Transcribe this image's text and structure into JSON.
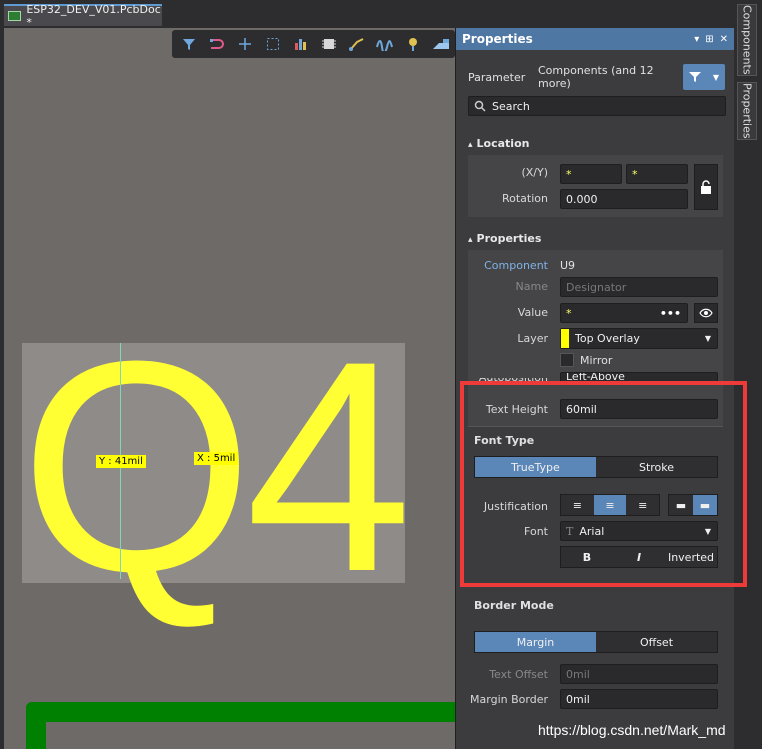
{
  "document_tab": {
    "title": "ESP32_DEV_V01.PcbDoc *"
  },
  "canvas": {
    "designator_text": "Q4",
    "y_tag": "Y : 41mil",
    "x_tag": "X : 5mil"
  },
  "toolbar_icons": [
    "filter-icon",
    "route-icon",
    "cross-icon",
    "select-box-icon",
    "chart-icon",
    "component-icon",
    "route-arc-icon",
    "meander-icon",
    "pin-icon",
    "layer-icon"
  ],
  "panel": {
    "title": "Properties",
    "header_buttons": [
      "▾",
      "⊞",
      "✕"
    ],
    "filter_label": "Parameter",
    "filter_value": "Components (and 12 more)",
    "search_placeholder": "Search",
    "location": {
      "section": "Location",
      "xy_label": "(X/Y)",
      "x_value": "*",
      "y_value": "*",
      "rotation_label": "Rotation",
      "rotation_value": "0.000"
    },
    "properties": {
      "section": "Properties",
      "component_label": "Component",
      "component_value": "U9",
      "name_label": "Name",
      "name_placeholder": "Designator",
      "value_label": "Value",
      "value_value": "*",
      "layer_label": "Layer",
      "layer_value": "Top Overlay",
      "layer_color": "#ffff00",
      "mirror_label": "Mirror",
      "autoposition_label": "Autoposition",
      "autoposition_value": "Left-Above",
      "text_height_label": "Text Height",
      "text_height_value": "60mil"
    },
    "font_type": {
      "section": "Font Type",
      "truetype": "TrueType",
      "stroke": "Stroke",
      "justification_label": "Justification",
      "font_label": "Font",
      "font_value": "Arial",
      "bold": "B",
      "italic": "I",
      "inverted": "Inverted"
    },
    "border_mode": {
      "section": "Border Mode",
      "margin": "Margin",
      "offset": "Offset",
      "text_offset_label": "Text Offset",
      "text_offset_value": "0mil",
      "margin_border_label": "Margin Border",
      "margin_border_value": "0mil"
    }
  },
  "rail": {
    "components": "Components",
    "properties": "Properties"
  },
  "watermark": "https://blog.csdn.net/Mark_md",
  "colors": {
    "accent": "#5a86b8",
    "highlight": "#ef3a3a",
    "silkscreen": "#ffff33"
  }
}
